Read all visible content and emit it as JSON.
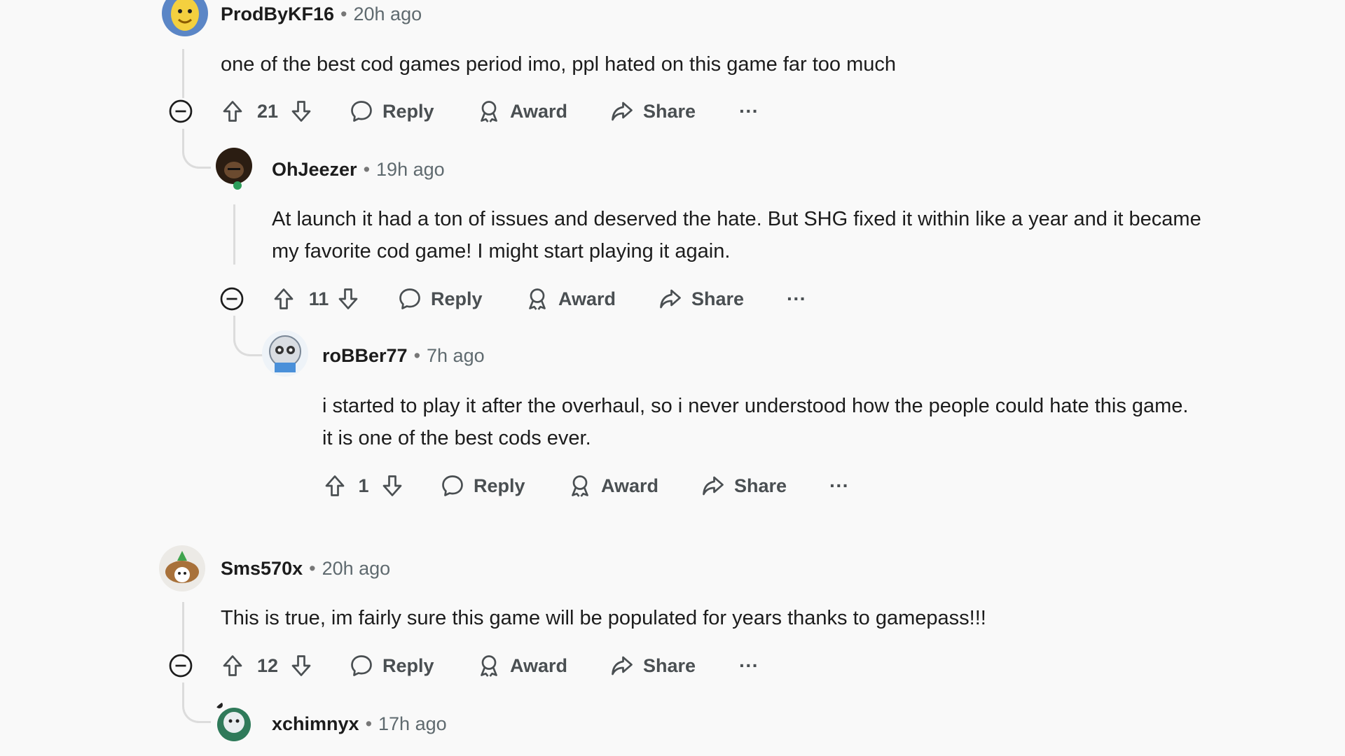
{
  "comments": [
    {
      "user": "ProdByKF16",
      "time": "20h ago",
      "lines": [
        "one of the best cod games period imo, ppl hated on this game far too much"
      ],
      "votes": "21"
    },
    {
      "user": "OhJeezer",
      "time": "19h ago",
      "lines": [
        "At launch it had a ton of issues and deserved the hate. But SHG fixed it within like a year and it became",
        "my favorite cod game! I might start playing it again."
      ],
      "votes": "11"
    },
    {
      "user": "roBBer77",
      "time": "7h ago",
      "lines": [
        "i started to play it after the overhaul, so i never understood how the people could hate this game.",
        "it is one of the best cods ever."
      ],
      "votes": "1"
    },
    {
      "user": "Sms570x",
      "time": "20h ago",
      "lines": [
        "This is true, im fairly sure this game will be populated for years thanks to gamepass!!!"
      ],
      "votes": "12"
    },
    {
      "user": "xchimnyx",
      "time": "17h ago"
    }
  ],
  "actions": {
    "reply": "Reply",
    "award": "Award",
    "share": "Share",
    "more": "···"
  },
  "separator": "•"
}
